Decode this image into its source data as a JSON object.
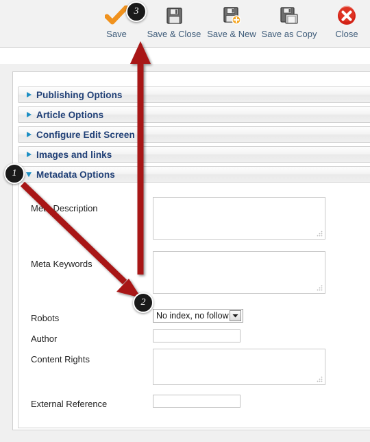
{
  "toolbar": {
    "buttons": [
      {
        "label": "Save",
        "icon": "checkmark-icon"
      },
      {
        "label": "Save & Close",
        "icon": "floppy-disk-icon"
      },
      {
        "label": "Save & New",
        "icon": "floppy-disk-plus-icon"
      },
      {
        "label": "Save as Copy",
        "icon": "floppy-disk-copy-icon"
      },
      {
        "label": "Close",
        "icon": "red-x-circle-icon"
      }
    ]
  },
  "accordion": {
    "panels": [
      {
        "label": "Publishing Options",
        "state": "collapsed"
      },
      {
        "label": "Article Options",
        "state": "collapsed"
      },
      {
        "label": "Configure Edit Screen",
        "state": "collapsed"
      },
      {
        "label": "Images and links",
        "state": "collapsed"
      },
      {
        "label": "Metadata Options",
        "state": "expanded"
      }
    ]
  },
  "metadata_form": {
    "fields": {
      "meta_description": {
        "label": "Meta Description",
        "value": "",
        "type": "textarea"
      },
      "meta_keywords": {
        "label": "Meta Keywords",
        "value": "",
        "type": "textarea"
      },
      "robots": {
        "label": "Robots",
        "value": "No index, no follow",
        "type": "select"
      },
      "author": {
        "label": "Author",
        "value": "",
        "type": "text"
      },
      "content_rights": {
        "label": "Content Rights",
        "value": "",
        "type": "textarea"
      },
      "external_reference": {
        "label": "External Reference",
        "value": "",
        "type": "text"
      }
    }
  },
  "annotations": {
    "callouts": [
      {
        "number": "1",
        "target": "metadata-options-panel"
      },
      {
        "number": "2",
        "target": "robots-select"
      },
      {
        "number": "3",
        "target": "save-and-close-button"
      }
    ],
    "arrow_color": "#a81414"
  }
}
